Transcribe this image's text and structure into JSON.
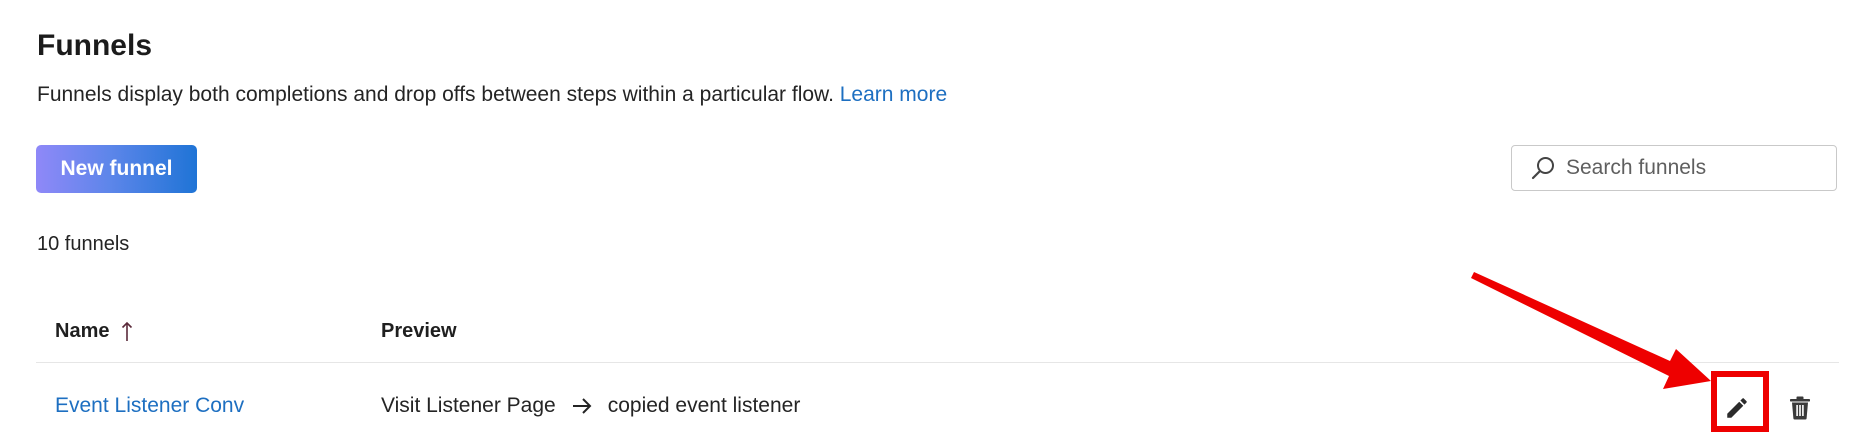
{
  "header": {
    "title": "Funnels",
    "description": "Funnels display both completions and drop offs between steps within a particular flow.",
    "learn_more_label": "Learn more"
  },
  "toolbar": {
    "new_funnel_label": "New funnel"
  },
  "search": {
    "placeholder": "Search funnels",
    "value": "",
    "icon": "search-icon"
  },
  "summary": {
    "count_label": "10 funnels"
  },
  "table": {
    "columns": {
      "name": "Name",
      "preview": "Preview"
    },
    "sort": {
      "column": "name",
      "direction": "ascending",
      "icon": "arrow-up-icon"
    },
    "rows": [
      {
        "name": "Event Listener Conv",
        "preview_steps": [
          "Visit Listener Page",
          "copied event listener"
        ],
        "actions": [
          "edit-icon",
          "trash-icon"
        ]
      }
    ]
  },
  "colors": {
    "link": "#1d6fc1",
    "button_gradient_start": "#8f88f8",
    "button_gradient_end": "#1f74d6",
    "annotation": "#ee0000",
    "text": "#242424"
  }
}
